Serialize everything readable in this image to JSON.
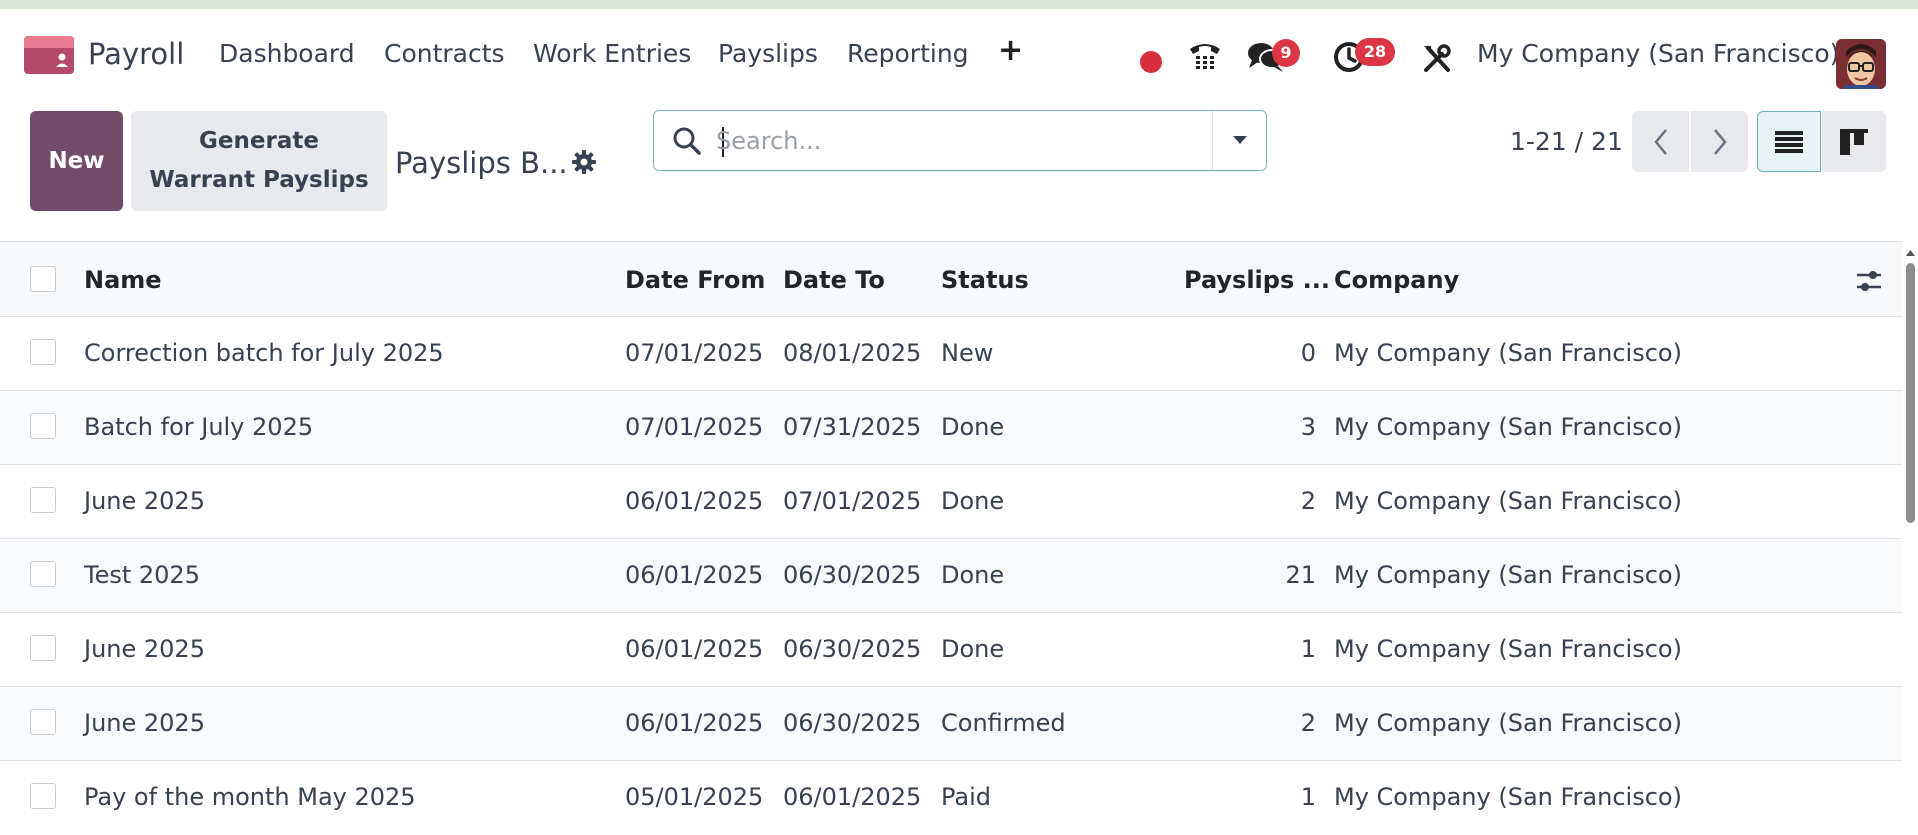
{
  "app": {
    "name": "Payroll",
    "brand_color": "#714b67"
  },
  "nav": {
    "items": [
      "Dashboard",
      "Contracts",
      "Work Entries",
      "Payslips",
      "Reporting"
    ],
    "plus": "+"
  },
  "systray": {
    "messages_badge": "9",
    "activities_badge": "28",
    "company": "My Company (San Francisco)"
  },
  "control_panel": {
    "new_label": "New",
    "generate_label": "Generate Warrant Payslips",
    "breadcrumb": "Payslips B...",
    "search_placeholder": "Search...",
    "pager": "1-21 / 21"
  },
  "table": {
    "headers": [
      "Name",
      "Date From",
      "Date To",
      "Status",
      "Payslips ...",
      "Company"
    ],
    "rows": [
      {
        "name": "Correction batch for July 2025",
        "date_from": "07/01/2025",
        "date_to": "08/01/2025",
        "status": "New",
        "payslips": "0",
        "company": "My Company (San Francisco)"
      },
      {
        "name": "Batch for July 2025",
        "date_from": "07/01/2025",
        "date_to": "07/31/2025",
        "status": "Done",
        "payslips": "3",
        "company": "My Company (San Francisco)"
      },
      {
        "name": "June 2025",
        "date_from": "06/01/2025",
        "date_to": "07/01/2025",
        "status": "Done",
        "payslips": "2",
        "company": "My Company (San Francisco)"
      },
      {
        "name": "Test 2025",
        "date_from": "06/01/2025",
        "date_to": "06/30/2025",
        "status": "Done",
        "payslips": "21",
        "company": "My Company (San Francisco)"
      },
      {
        "name": "June 2025",
        "date_from": "06/01/2025",
        "date_to": "06/30/2025",
        "status": "Done",
        "payslips": "1",
        "company": "My Company (San Francisco)"
      },
      {
        "name": "June 2025",
        "date_from": "06/01/2025",
        "date_to": "06/30/2025",
        "status": "Confirmed",
        "payslips": "2",
        "company": "My Company (San Francisco)"
      },
      {
        "name": "Pay of the month May 2025",
        "date_from": "05/01/2025",
        "date_to": "06/01/2025",
        "status": "Paid",
        "payslips": "1",
        "company": "My Company (San Francisco)"
      }
    ]
  },
  "icons": {
    "app_logo": "payroll-logo-icon",
    "record": "record-dot-icon",
    "phone": "phone-icon",
    "messages": "chat-icon",
    "activities": "clock-icon",
    "debug": "tools-icon",
    "settings": "gear-icon",
    "search": "search-icon",
    "dropdown": "caret-down-icon",
    "prev": "chevron-left-icon",
    "next": "chevron-right-icon",
    "list_view": "list-view-icon",
    "kanban_view": "kanban-view-icon",
    "column_options": "sliders-icon"
  }
}
